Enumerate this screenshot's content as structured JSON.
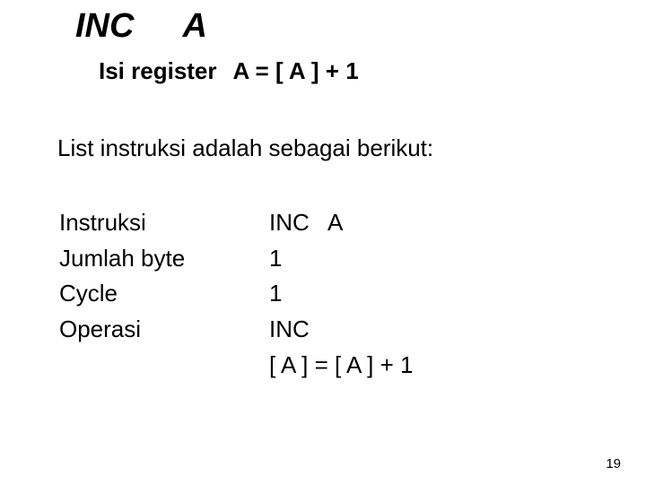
{
  "title": {
    "mnemonic": "INC",
    "operand": "A"
  },
  "subtitle": {
    "label": "Isi register",
    "expr": "A = [ A ] + 1"
  },
  "list_heading": "List instruksi adalah sebagai berikut:",
  "props": {
    "instruksi": {
      "label": "Instruksi",
      "value": "INC   A"
    },
    "jumlah_byte": {
      "label": "Jumlah byte",
      "value": "1"
    },
    "cycle": {
      "label": "Cycle",
      "value": "1"
    },
    "operasi": {
      "label": "Operasi",
      "value": "INC",
      "value2": "[ A ] = [ A ] + 1"
    }
  },
  "page_number": "19"
}
